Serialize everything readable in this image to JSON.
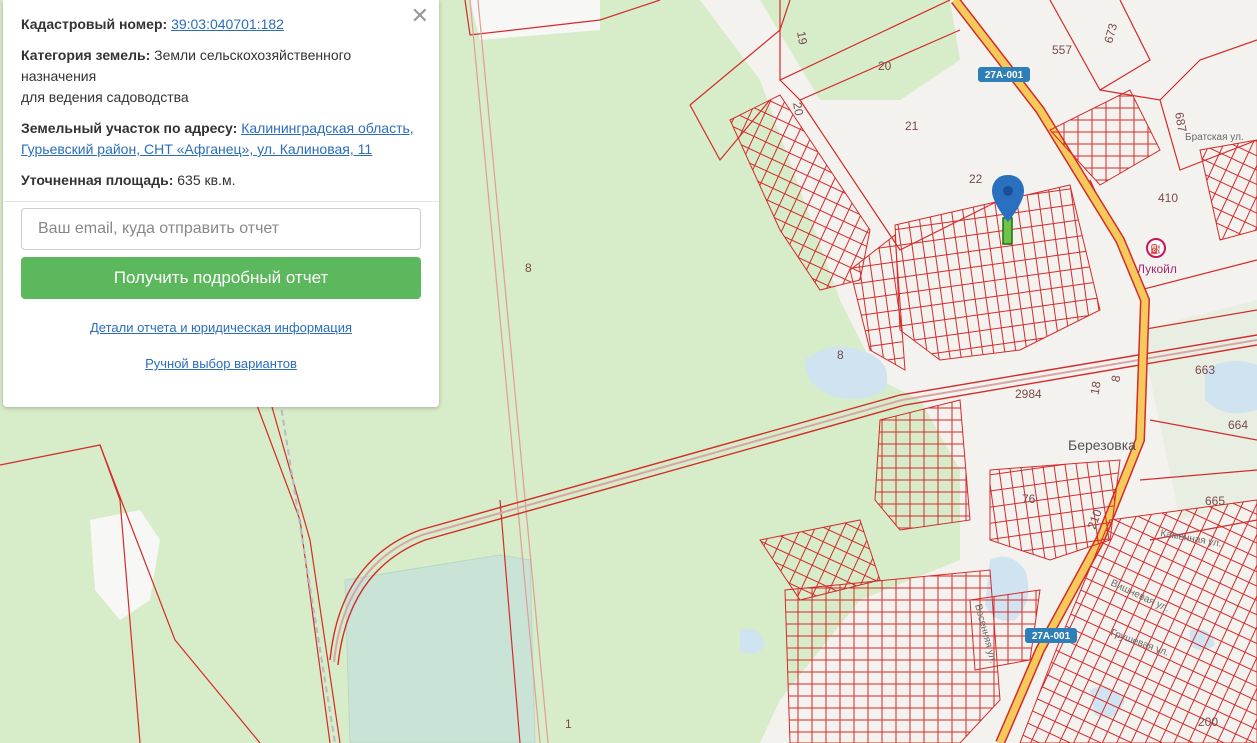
{
  "info_panel": {
    "cadastral_label": "Кадастровый номер:",
    "cadastral_value": "39:03:040701:182",
    "category_label": "Категория земель:",
    "category_value_1": "Земли сельскохозяйственного назначения",
    "category_value_2": "для ведения садоводства",
    "address_label": "Земельный участок по адресу:",
    "address_value": "Калининградская область, Гурьевский район, СНТ «Афганец», ул. Калиновая, 11",
    "area_label": "Уточненная площадь:",
    "area_value": "635 кв.м.",
    "email_placeholder": "Ваш email, куда отправить отчет",
    "get_report_button": "Получить подробный отчет",
    "details_link": "Детали отчета и юридическая информация",
    "manual_link": "Ручной выбор вариантов",
    "close_icon": "close-icon"
  },
  "map": {
    "parcel_numbers": [
      "557",
      "673",
      "20",
      "21",
      "22",
      "20",
      "19",
      "410",
      "687",
      "8",
      "8",
      "2984",
      "18",
      "8",
      "663",
      "664",
      "665",
      "76",
      "210",
      "200",
      "1"
    ],
    "place_name": "Березовка",
    "road_badges": [
      "27А-001",
      "27А-001"
    ],
    "poi": "Лукойл",
    "streets": [
      "Братская ул.",
      "Каменная ул.",
      "Вишневая ул.",
      "Грушевая ул.",
      "Весенняя ул."
    ],
    "colors": {
      "green_land": "#d7ecc8",
      "parcel_border": "#d42b2b",
      "road": "#f5c95a",
      "water": "#cfe3f0",
      "marker": "#2b6fc0"
    }
  }
}
